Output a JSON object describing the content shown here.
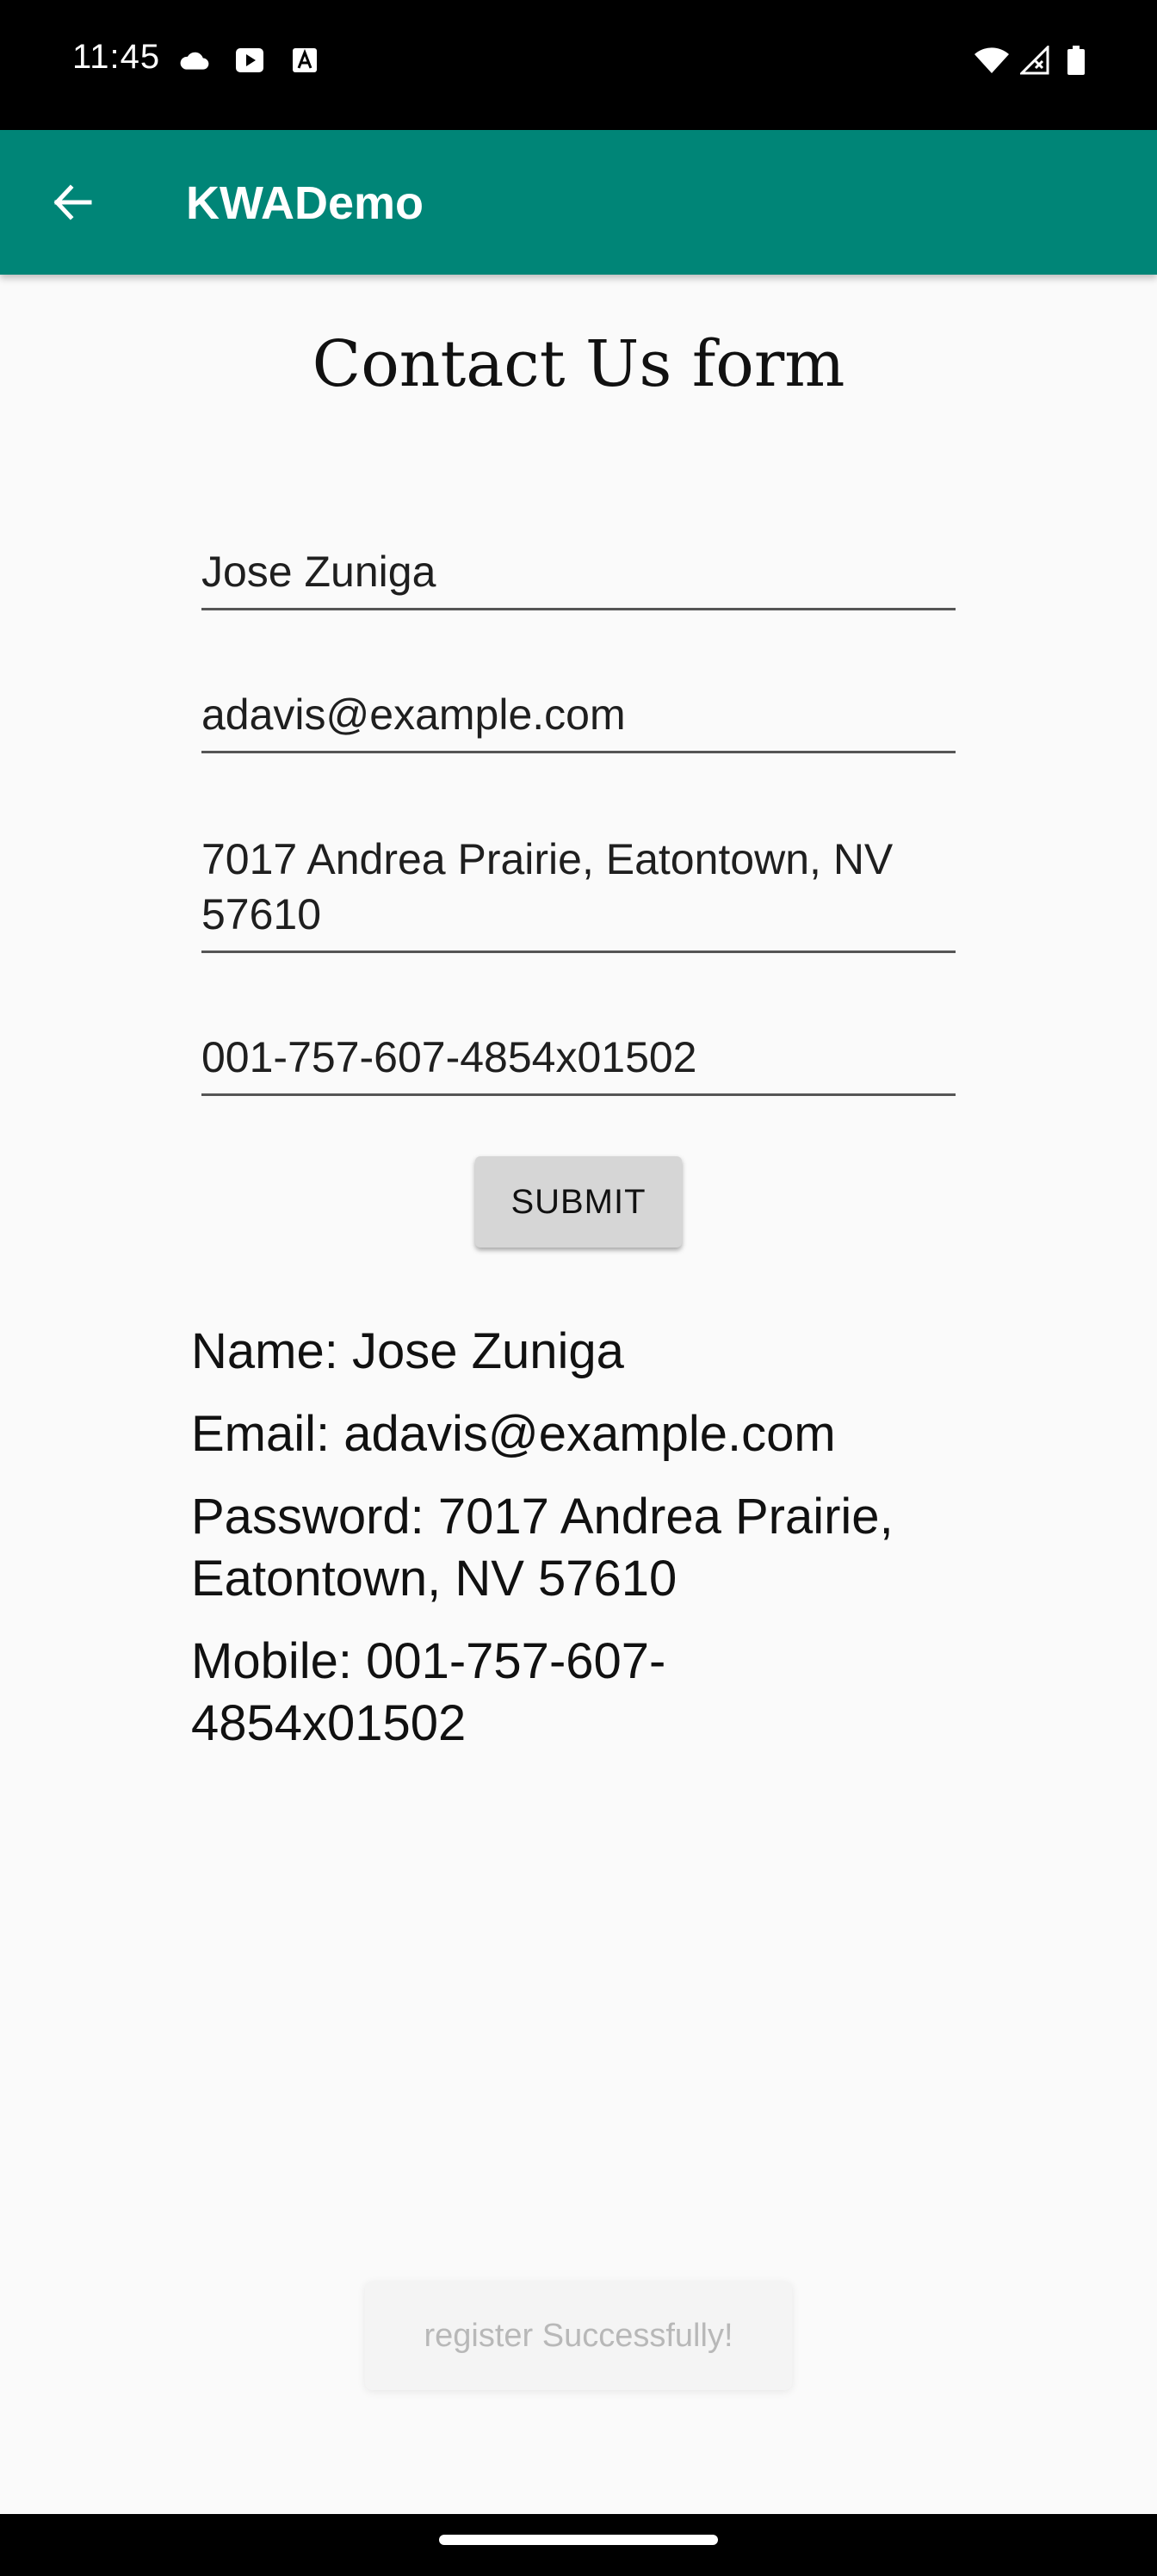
{
  "status_bar": {
    "time": "11:45",
    "icons_left": [
      "cloud-icon",
      "play-icon",
      "a-badge-icon"
    ],
    "icons_right": [
      "wifi-icon",
      "signal-icon",
      "battery-icon"
    ]
  },
  "app_bar": {
    "title": "KWADemo",
    "back_icon": "arrow-back-icon",
    "color": "#008577"
  },
  "form": {
    "title": "Contact Us form",
    "name_value": "Jose Zuniga",
    "email_value": "adavis@example.com",
    "address_value": "7017 Andrea Prairie, Eatontown, NV 57610",
    "mobile_value": "001-757-607-4854x01502",
    "submit_label": "SUBMIT"
  },
  "result": {
    "name_line": "Name: Jose Zuniga",
    "email_line": "Email: adavis@example.com",
    "password_line": "Password: 7017 Andrea Prairie, Eatontown, NV 57610",
    "mobile_line": "Mobile: 001-757-607-4854x01502"
  },
  "toast": {
    "message": "register Successfully!"
  }
}
